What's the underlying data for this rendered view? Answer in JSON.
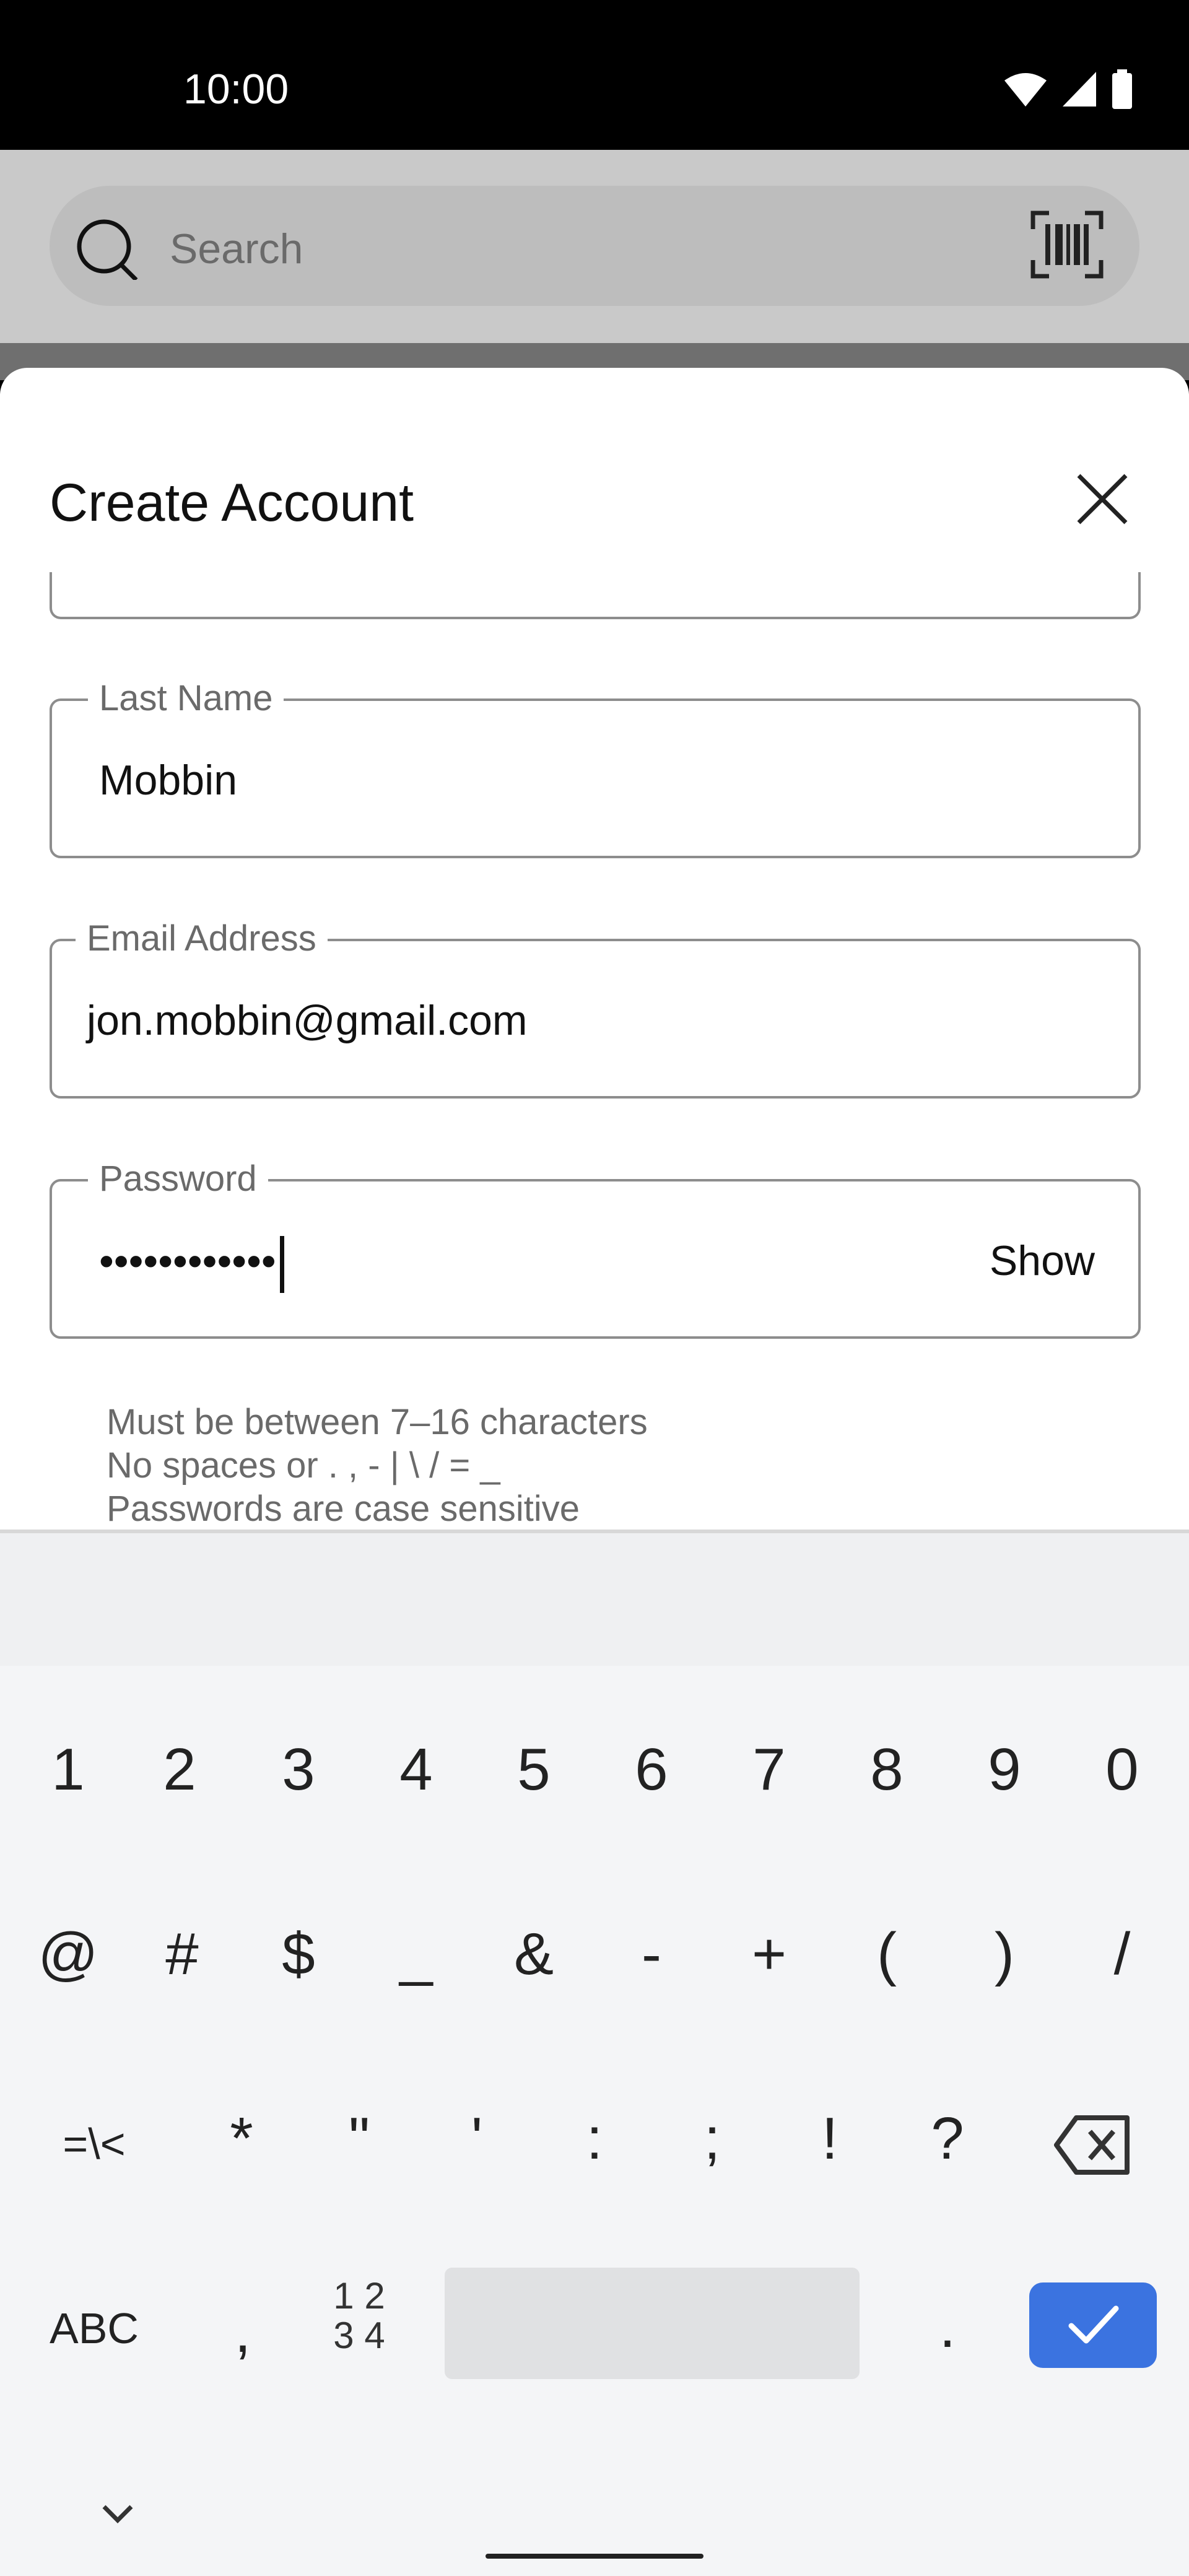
{
  "status": {
    "time": "10:00"
  },
  "app": {
    "search_placeholder": "Search"
  },
  "sheet": {
    "title": "Create Account",
    "fields": {
      "last_name": {
        "label": "Last Name",
        "value": "Mobbin"
      },
      "email": {
        "label": "Email Address",
        "value": "jon.mobbin@gmail.com"
      },
      "password": {
        "label": "Password",
        "value": "••••••••••••",
        "toggle_label": "Show"
      }
    },
    "hints": [
      "Must be between 7–16 characters",
      "No spaces or . , - | \\ / = _",
      "Passwords are case sensitive"
    ]
  },
  "keyboard": {
    "row1": [
      "1",
      "2",
      "3",
      "4",
      "5",
      "6",
      "7",
      "8",
      "9",
      "0"
    ],
    "row2": [
      "@",
      "#",
      "$",
      "_",
      "&",
      "-",
      "+",
      "(",
      ")",
      "/"
    ],
    "row3": [
      "=\\<",
      "*",
      "\"",
      "'",
      ":",
      ";",
      "!",
      "?"
    ],
    "row4": {
      "abc": "ABC",
      "comma": ",",
      "numpad_line1": "1 2",
      "numpad_line2": "3 4",
      "period": "."
    }
  },
  "colors": {
    "accent": "#3b73e0",
    "sheet_bg": "#ffffff",
    "keyboard_bg": "#f4f5f7"
  }
}
